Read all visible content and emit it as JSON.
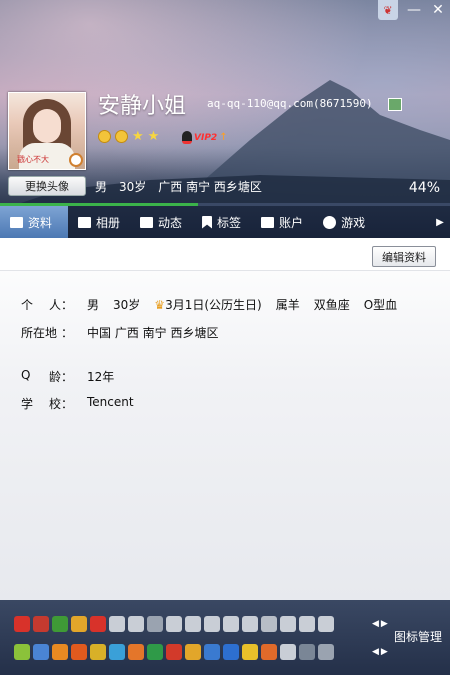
{
  "window": {
    "skin_label": "❦",
    "minimize_label": "—",
    "close_label": "✕"
  },
  "header": {
    "avatar_caption": "戳心不大",
    "change_avatar_label": "更换头像",
    "nickname": "安静小姐",
    "email": "aq-qq-110@qq.com(8671590)",
    "vip_label": "VIP2",
    "vip_arrow": "↑",
    "gender": "男",
    "age": "30岁",
    "location": "广西 南宁 西乡塘区",
    "completion_percent": "44%",
    "completion_value": 0.44
  },
  "tabs": [
    {
      "label": "资料",
      "icon": "profile-card-icon"
    },
    {
      "label": "相册",
      "icon": "album-icon"
    },
    {
      "label": "动态",
      "icon": "feed-list-icon"
    },
    {
      "label": "标签",
      "icon": "tag-flag-icon"
    },
    {
      "label": "账户",
      "icon": "account-card-icon"
    },
    {
      "label": "游戏",
      "icon": "game-icon"
    }
  ],
  "tab_next": "▶",
  "main": {
    "edit_label": "编辑资料",
    "rows": [
      {
        "label_a": "个",
        "label_b": "人：",
        "values": [
          "男",
          "30岁",
          "3月1日(公历生日)",
          "属羊",
          "双鱼座",
          "O型血"
        ]
      },
      {
        "label_a": "所在地",
        "label_b": "：",
        "values": [
          "中国 广西 南宁 西乡塘区"
        ]
      },
      {
        "label_a": "Q",
        "label_b": "龄：",
        "values": [
          "12年"
        ]
      },
      {
        "label_a": "学",
        "label_b": "校：",
        "values": [
          "Tencent"
        ]
      }
    ]
  },
  "bottom": {
    "icon_manage_label": "图标管理",
    "arrow_left": "◀",
    "arrow_right": "▶",
    "row1_colors": [
      "#d8322a",
      "#c53a2f",
      "#3f9a36",
      "#e2a62a",
      "#d8322a",
      "#c9ced6",
      "#c9ced6",
      "#9aa3b0",
      "#c9ced6",
      "#c9ced6",
      "#c9ced6",
      "#c9ced6",
      "#c9ced6",
      "#b7bdc6",
      "#c9ced6",
      "#c9ced6",
      "#c9ced6"
    ],
    "row2_colors": [
      "#8bc23a",
      "#4a84d4",
      "#e88a22",
      "#e05a1e",
      "#d8b028",
      "#3aa0d8",
      "#e4762a",
      "#2f9a48",
      "#d23a2a",
      "#e2a62a",
      "#3a7ad0",
      "#2d6fd0",
      "#e8c02a",
      "#e06a2a",
      "#c9ced6",
      "#7a8696",
      "#9aa3b0"
    ]
  }
}
